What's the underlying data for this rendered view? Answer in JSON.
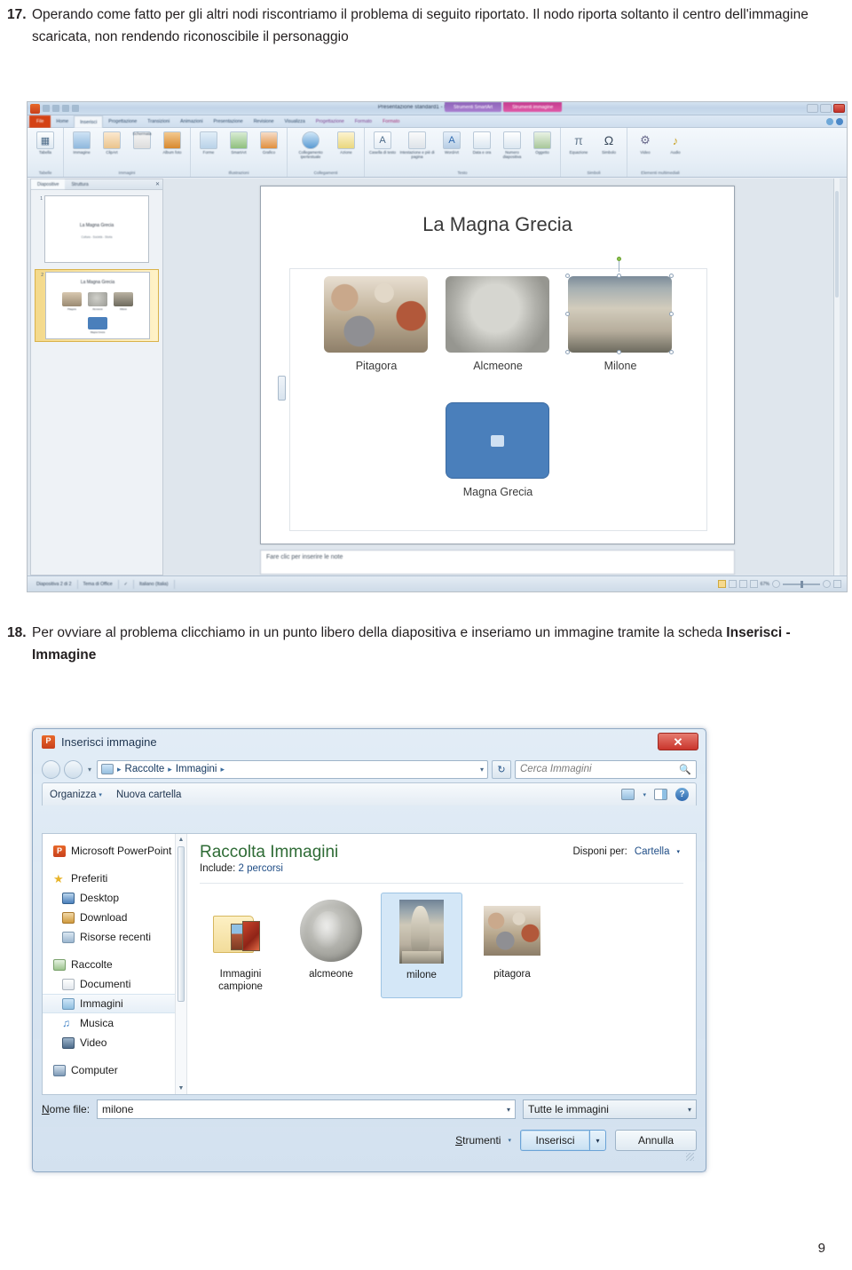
{
  "document": {
    "paragraphs": [
      {
        "number": "17.",
        "text_parts": [
          {
            "text": "Operando come fatto per gli altri nodi riscontriamo il problema di seguito riportato. Il nodo riporta soltanto il centro dell'immagine scaricata, non rendendo riconoscibile il personaggio",
            "bold": false
          }
        ]
      },
      {
        "number": "18.",
        "text_parts": [
          {
            "text": "Per ovviare al problema clicchiamo in un punto libero della diapositiva e inseriamo un immagine tramite la scheda ",
            "bold": false
          },
          {
            "text": "Inserisci - Immagine",
            "bold": true
          }
        ]
      }
    ],
    "page_number": "9"
  },
  "powerpoint": {
    "window_title": "Presentazione standard1 - Microsoft PowerPoint",
    "app_icon": "powerpoint-orb-icon",
    "quick_access": [
      "save-icon",
      "undo-icon",
      "redo-icon",
      "customize-icon"
    ],
    "window_buttons": [
      "minimize-icon",
      "restore-icon",
      "close-icon"
    ],
    "contextual_tab_groups": [
      {
        "label": "Strumenti SmartArt",
        "color": "#a97fd0"
      },
      {
        "label": "Strumenti immagine",
        "color": "#e05aa8"
      }
    ],
    "tabs": [
      {
        "label": "File",
        "state": "file"
      },
      {
        "label": "Home",
        "state": "normal"
      },
      {
        "label": "Inserisci",
        "state": "active"
      },
      {
        "label": "Progettazione",
        "state": "normal"
      },
      {
        "label": "Transizioni",
        "state": "normal"
      },
      {
        "label": "Animazioni",
        "state": "normal"
      },
      {
        "label": "Presentazione",
        "state": "normal"
      },
      {
        "label": "Revisione",
        "state": "normal"
      },
      {
        "label": "Visualizza",
        "state": "normal"
      },
      {
        "label": "Progettazione",
        "state": "ctx"
      },
      {
        "label": "Formato",
        "state": "ctx"
      },
      {
        "label": "Formato",
        "state": "ctx2"
      }
    ],
    "ribbon_groups": [
      {
        "label": "Tabelle",
        "items": [
          {
            "label": "Tabella",
            "icon": "table-icon",
            "style": ""
          }
        ]
      },
      {
        "label": "Immagini",
        "items": [
          {
            "label": "Immagine",
            "icon": "picture-icon",
            "style": "img"
          },
          {
            "label": "ClipArt",
            "icon": "clipart-icon",
            "style": "clip"
          },
          {
            "label": "Schermata",
            "icon": "screenshot-icon",
            "style": "shot"
          },
          {
            "label": "Album foto",
            "icon": "photo-album-icon",
            "style": "album"
          }
        ]
      },
      {
        "label": "Illustrazioni",
        "items": [
          {
            "label": "Forme",
            "icon": "shapes-icon",
            "style": "forme"
          },
          {
            "label": "SmartArt",
            "icon": "smartart-icon",
            "style": "smart"
          },
          {
            "label": "Grafico",
            "icon": "chart-icon",
            "style": "graf"
          }
        ]
      },
      {
        "label": "Collegamenti",
        "items": [
          {
            "label": "Collegamento ipertestuale",
            "icon": "hyperlink-icon",
            "style": "link"
          },
          {
            "label": "Azione",
            "icon": "action-icon",
            "style": "azione"
          }
        ]
      },
      {
        "label": "Testo",
        "items": [
          {
            "label": "Casella di testo",
            "icon": "textbox-icon",
            "style": "cas"
          },
          {
            "label": "Intestazione e piè di pagina",
            "icon": "header-footer-icon",
            "style": "piede"
          },
          {
            "label": "WordArt",
            "icon": "wordart-icon",
            "style": "word"
          },
          {
            "label": "Data e ora",
            "icon": "date-time-icon",
            "style": "data"
          },
          {
            "label": "Numero diapositiva",
            "icon": "slide-number-icon",
            "style": "num"
          },
          {
            "label": "Oggetto",
            "icon": "object-icon",
            "style": "ogg"
          }
        ]
      },
      {
        "label": "Simboli",
        "items": [
          {
            "label": "Equazione",
            "icon": "equation-icon",
            "style": "eq",
            "glyph": "π"
          },
          {
            "label": "Simbolo",
            "icon": "symbol-icon",
            "style": "sym",
            "glyph": "Ω"
          }
        ]
      },
      {
        "label": "Elementi multimediali",
        "items": [
          {
            "label": "Video",
            "icon": "video-icon",
            "style": "video",
            "glyph": "☸"
          },
          {
            "label": "Audio",
            "icon": "audio-icon",
            "style": "audio",
            "glyph": "🔊"
          }
        ]
      }
    ],
    "left_pane": {
      "tabs": [
        {
          "label": "Diapositive",
          "active": true
        },
        {
          "label": "Struttura",
          "active": false
        }
      ],
      "close_icon": "close-pane-icon",
      "slides": [
        {
          "number": "1",
          "title": "La Magna Grecia",
          "subtitle": "Cultura - Società - Storia",
          "selected": false
        },
        {
          "number": "2",
          "title": "La Magna Grecia",
          "selected": true,
          "captions": [
            "Pitagora",
            "Alcmeone",
            "Milone",
            "Magna Grecia"
          ]
        }
      ]
    },
    "slide": {
      "title": "La Magna Grecia",
      "smartart": {
        "picture_nodes": [
          {
            "caption": "Pitagora",
            "image": "fresco-thumbnail",
            "selected": false
          },
          {
            "caption": "Alcmeone",
            "image": "coin-thumbnail",
            "selected": false
          },
          {
            "caption": "Milone",
            "image": "statue-thumbnail",
            "selected": true
          }
        ],
        "placeholder_node": {
          "caption": "Magna Grecia",
          "fill_color": "#4a7fbb",
          "icon": "picture-placeholder-icon"
        }
      }
    },
    "notes_placeholder": "Fare clic per inserire le note",
    "status_bar": {
      "slide_counter": "Diapositiva 2 di 2",
      "theme": "Tema di Office",
      "language_icon": "spellcheck-icon",
      "language": "Italiano (Italia)",
      "view_buttons": [
        "normal-view-icon",
        "slide-sorter-icon",
        "reading-view-icon",
        "slideshow-icon"
      ],
      "zoom": "67%",
      "zoom_out_icon": "zoom-out-icon",
      "zoom_in_icon": "zoom-in-icon",
      "fit_icon": "fit-slide-icon"
    }
  },
  "dialog": {
    "title": "Inserisci immagine",
    "app_icon": "powerpoint-icon",
    "app_icon_glyph": "P",
    "close_label": "✕",
    "nav": {
      "back_icon": "back-arrow-icon",
      "forward_icon": "forward-arrow-icon",
      "history_icon": "chevron-down-icon",
      "address_icon": "pictures-library-icon",
      "breadcrumbs": [
        "Raccolte",
        "Immagini"
      ],
      "breadcrumb_separator": "▸",
      "dropdown_icon": "chevron-down-icon",
      "refresh_icon": "refresh-icon",
      "search_placeholder": "Cerca Immagini",
      "search_icon": "search-icon"
    },
    "toolbar": {
      "organize_label": "Organizza",
      "organize_caret": "▾",
      "new_folder_label": "Nuova cartella",
      "view_icon": "change-view-icon",
      "view_caret": "▾",
      "preview_pane_icon": "preview-pane-icon",
      "help_icon": "help-icon",
      "help_glyph": "?"
    },
    "nav_pane": [
      {
        "label": "Microsoft PowerPoint",
        "icon": "ppt-icon",
        "level": 0,
        "selected": false,
        "gap_before": false
      },
      {
        "label": "Preferiti",
        "icon": "favorites-star-icon",
        "level": 0,
        "selected": false,
        "gap_before": true
      },
      {
        "label": "Desktop",
        "icon": "desktop-icon",
        "level": 1,
        "selected": false,
        "gap_before": false
      },
      {
        "label": "Download",
        "icon": "download-icon",
        "level": 1,
        "selected": false,
        "gap_before": false
      },
      {
        "label": "Risorse recenti",
        "icon": "recent-places-icon",
        "level": 1,
        "selected": false,
        "gap_before": false
      },
      {
        "label": "Raccolte",
        "icon": "libraries-icon",
        "level": 0,
        "selected": false,
        "gap_before": true
      },
      {
        "label": "Documenti",
        "icon": "documents-icon",
        "level": 1,
        "selected": false,
        "gap_before": false
      },
      {
        "label": "Immagini",
        "icon": "pictures-icon",
        "level": 1,
        "selected": true,
        "gap_before": false
      },
      {
        "label": "Musica",
        "icon": "music-icon",
        "level": 1,
        "selected": false,
        "gap_before": false
      },
      {
        "label": "Video",
        "icon": "videos-icon",
        "level": 1,
        "selected": false,
        "gap_before": false
      },
      {
        "label": "Computer",
        "icon": "computer-icon",
        "level": 0,
        "selected": false,
        "gap_before": true
      }
    ],
    "file_pane": {
      "library_title": "Raccolta Immagini",
      "include_label": "Include:",
      "include_value": "2 percorsi",
      "arrange_label": "Disponi per:",
      "arrange_value": "Cartella",
      "arrange_caret": "▾",
      "items": [
        {
          "name": "Immagini campione",
          "kind": "folder",
          "selected": false
        },
        {
          "name": "alcmeone",
          "kind": "coin",
          "selected": false
        },
        {
          "name": "milone",
          "kind": "statue",
          "selected": true
        },
        {
          "name": "pitagora",
          "kind": "fresco",
          "selected": false
        }
      ]
    },
    "footer": {
      "filename_label": "Nome file:",
      "filename_underline": "N",
      "filename_value": "milone",
      "filetype_value": "Tutte le immagini",
      "tools_label": "Strumenti",
      "tools_underline": "S",
      "tools_caret": "▾",
      "insert_label": "Inserisci",
      "insert_caret": "▾",
      "cancel_label": "Annulla",
      "combo_caret": "▾"
    }
  }
}
